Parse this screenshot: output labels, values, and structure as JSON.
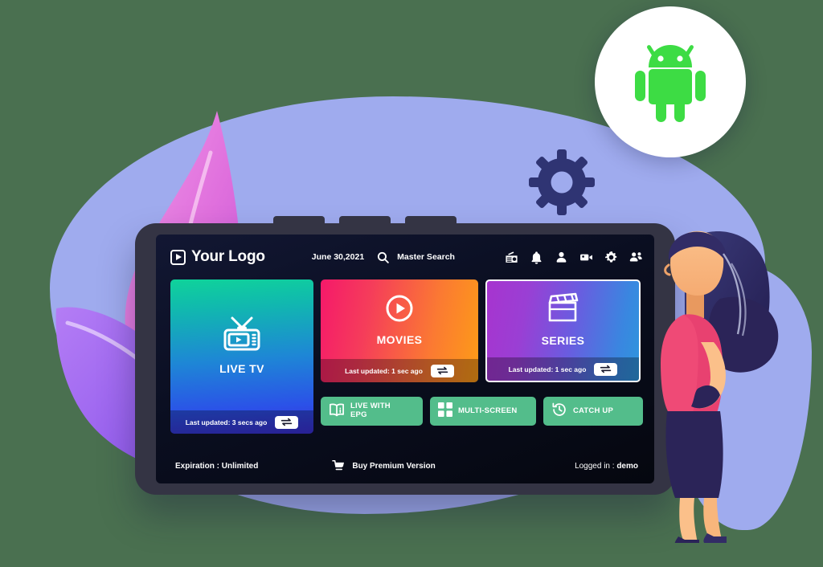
{
  "theme": {
    "page_background": "#4a7050",
    "blob_color": "#9fabee",
    "leaf_pink": "#e57fe0",
    "leaf_purple": "#a86cf0",
    "gear_color": "#2f3473",
    "android_green": "#3ddc44",
    "screen_background": "#0a0e20",
    "tablet_frame": "#343444",
    "accent_green": "#53bd8b"
  },
  "badges": {
    "android_icon": "android-robot-icon",
    "gear_icon": "gear-icon"
  },
  "header": {
    "logo_icon": "play-square-icon",
    "logo_text": "Your Logo",
    "date": "June 30,2021",
    "search_icon": "search-icon",
    "search_label": "Master Search",
    "icons": [
      {
        "name": "radio-icon",
        "label": "Radio"
      },
      {
        "name": "bell-icon",
        "label": "Notifications"
      },
      {
        "name": "user-icon",
        "label": "Account"
      },
      {
        "name": "video-camera-icon",
        "label": "Recordings"
      },
      {
        "name": "gear-icon",
        "label": "Settings"
      },
      {
        "name": "users-icon",
        "label": "Profiles"
      }
    ]
  },
  "cards": [
    {
      "id": "live-tv",
      "label": "LIVE TV",
      "icon": "tv-icon",
      "updated": "Last updated: 3 secs ago",
      "refresh_icon": "refresh-icon",
      "selected": false
    },
    {
      "id": "movies",
      "label": "MOVIES",
      "icon": "play-circle-icon",
      "updated": "Last updated: 1 sec ago",
      "refresh_icon": "refresh-icon",
      "selected": false
    },
    {
      "id": "series",
      "label": "SERIES",
      "icon": "clapperboard-icon",
      "updated": "Last updated: 1 sec ago",
      "refresh_icon": "refresh-icon",
      "selected": true
    }
  ],
  "quick_actions": [
    {
      "id": "live-with-epg",
      "label": "LIVE WITH\nEPG",
      "icon": "book-info-icon"
    },
    {
      "id": "multi-screen",
      "label": "MULTI-SCREEN",
      "icon": "grid-icon"
    },
    {
      "id": "catch-up",
      "label": "CATCH UP",
      "icon": "clock-rewind-icon"
    }
  ],
  "footer": {
    "expiration": "Expiration : Unlimited",
    "premium_icon": "cart-icon",
    "premium_label": "Buy Premium Version",
    "logged_in_prefix": "Logged in : ",
    "logged_in_user": "demo"
  }
}
